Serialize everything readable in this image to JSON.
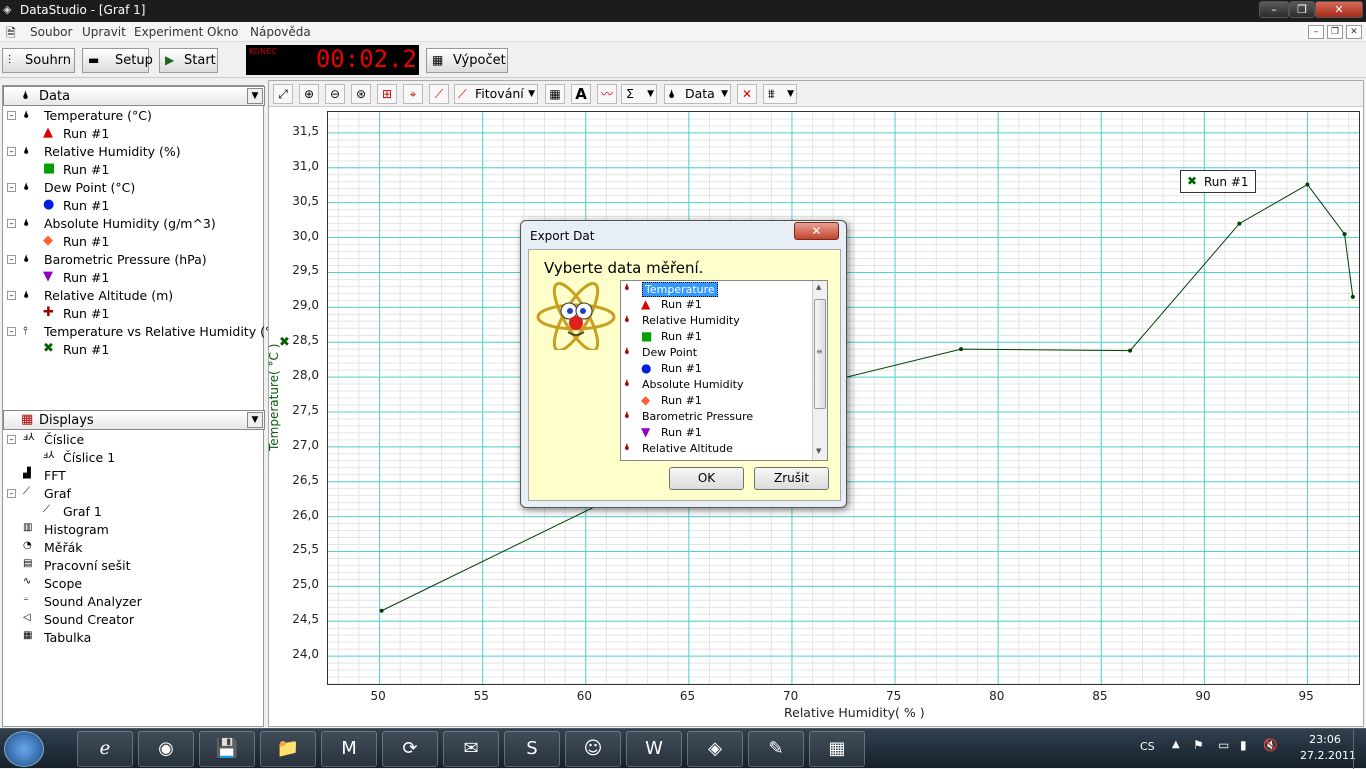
{
  "window": {
    "title": "DataStudio - [Graf 1]"
  },
  "menu": [
    "Soubor",
    "Upravit",
    "Experiment",
    "Okno",
    "Nápověda"
  ],
  "toolbar": {
    "summary": "Souhrn",
    "setup": "Setup",
    "start": "Start",
    "calc": "Výpočet",
    "timer_label": "KONEC",
    "timer": "00:02.2"
  },
  "data_panel": {
    "title": "Data",
    "items": [
      {
        "label": "Temperature (°C)",
        "run": "Run #1",
        "marker": "▲",
        "color": "#e00000"
      },
      {
        "label": "Relative Humidity (%)",
        "run": "Run #1",
        "marker": "■",
        "color": "#00a000"
      },
      {
        "label": "Dew Point (°C)",
        "run": "Run #1",
        "marker": "●",
        "color": "#0020e0"
      },
      {
        "label": "Absolute Humidity (g/m^3)",
        "run": "Run #1",
        "marker": "◆",
        "color": "#ff6030"
      },
      {
        "label": "Barometric Pressure (hPa)",
        "run": "Run #1",
        "marker": "▼",
        "color": "#9000c0"
      },
      {
        "label": "Relative Altitude (m)",
        "run": "Run #1",
        "marker": "✚",
        "color": "#a00000"
      },
      {
        "label": "Temperature vs Relative Humidity (°C)",
        "run": "Run #1",
        "marker": "✖",
        "color": "#006000"
      }
    ]
  },
  "displays_panel": {
    "title": "Displays",
    "items": [
      {
        "label": "Číslice",
        "level": 0,
        "icon": "digits-icon"
      },
      {
        "label": "Číslice 1",
        "level": 1,
        "icon": "digits-icon"
      },
      {
        "label": "FFT",
        "level": 0,
        "icon": "fft-icon"
      },
      {
        "label": "Graf",
        "level": 0,
        "icon": "graph-icon"
      },
      {
        "label": "Graf 1",
        "level": 1,
        "icon": "graph-icon"
      },
      {
        "label": "Histogram",
        "level": 0,
        "icon": "histogram-icon"
      },
      {
        "label": "Měřák",
        "level": 0,
        "icon": "meter-icon"
      },
      {
        "label": "Pracovní sešit",
        "level": 0,
        "icon": "workbook-icon"
      },
      {
        "label": "Scope",
        "level": 0,
        "icon": "scope-icon"
      },
      {
        "label": "Sound Analyzer",
        "level": 0,
        "icon": "sound-analyzer-icon"
      },
      {
        "label": "Sound Creator",
        "level": 0,
        "icon": "sound-creator-icon"
      },
      {
        "label": "Tabulka",
        "level": 0,
        "icon": "table-icon"
      }
    ]
  },
  "graph_toolbar": {
    "fit": "Fitování",
    "data": "Data"
  },
  "chart_data": {
    "type": "line",
    "xlabel": "Relative Humidity( % )",
    "ylabel": "Temperature( °C )",
    "xlim": [
      47.5,
      97.5
    ],
    "ylim": [
      23.6,
      31.8
    ],
    "x_ticks": [
      50,
      55,
      60,
      65,
      70,
      75,
      80,
      85,
      90,
      95
    ],
    "y_ticks": [
      24.0,
      24.5,
      25.0,
      25.5,
      26.0,
      26.5,
      27.0,
      27.5,
      28.0,
      28.5,
      29.0,
      29.5,
      30.0,
      30.5,
      31.0,
      31.5
    ],
    "y_tick_labels": [
      "24,0",
      "24,5",
      "25,0",
      "25,5",
      "26,0",
      "26,5",
      "27,0",
      "27,5",
      "28,0",
      "28,5",
      "29,0",
      "29,5",
      "30,0",
      "30,5",
      "31,0",
      "31,5"
    ],
    "grid": true,
    "series": [
      {
        "name": "Run #1",
        "color": "#004000",
        "x": [
          50.1,
          60.5,
          69.2,
          78.2,
          86.4,
          91.7,
          95.0,
          96.8,
          97.2
        ],
        "y": [
          24.65,
          26.15,
          27.75,
          28.4,
          28.38,
          30.2,
          30.76,
          30.05,
          29.15
        ]
      }
    ],
    "legend": "Run #1",
    "legend_position": "top-right"
  },
  "dialog": {
    "title": "Export Dat",
    "heading": "Vyberte data měření.",
    "list": [
      {
        "label": "Temperature",
        "run": false,
        "selected": true
      },
      {
        "label": "Run #1",
        "run": true,
        "marker": "▲",
        "color": "#e00000"
      },
      {
        "label": "Relative Humidity",
        "run": false
      },
      {
        "label": "Run #1",
        "run": true,
        "marker": "■",
        "color": "#00a000"
      },
      {
        "label": "Dew Point",
        "run": false
      },
      {
        "label": "Run #1",
        "run": true,
        "marker": "●",
        "color": "#0020e0"
      },
      {
        "label": "Absolute Humidity",
        "run": false
      },
      {
        "label": "Run #1",
        "run": true,
        "marker": "◆",
        "color": "#ff6030"
      },
      {
        "label": "Barometric Pressure",
        "run": false
      },
      {
        "label": "Run #1",
        "run": true,
        "marker": "▼",
        "color": "#9000c0"
      },
      {
        "label": "Relative Altitude",
        "run": false
      }
    ],
    "ok": "OK",
    "cancel": "Zrušit"
  },
  "taskbar": {
    "apps": [
      "windows-start-icon",
      "internet-explorer-icon",
      "chrome-icon",
      "save-disk-icon",
      "file-explorer-icon",
      "gmail-icon",
      "refresh-app-icon",
      "outlook-icon",
      "skype-icon",
      "messenger-icon",
      "word-icon",
      "datastudio-icon",
      "paint-icon",
      "movie-icon"
    ],
    "lang": "CS",
    "time": "23:06",
    "date": "27.2.2011"
  }
}
